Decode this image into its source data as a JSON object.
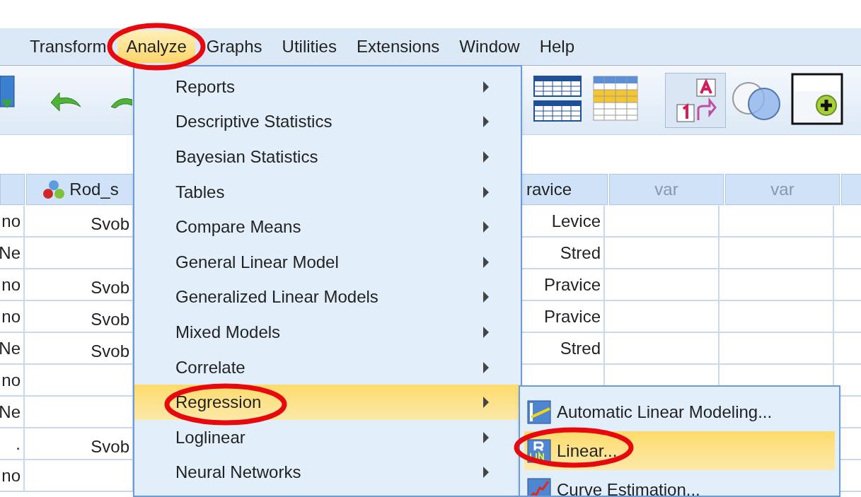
{
  "menu_bar": [
    {
      "label": "Transform",
      "selected": false
    },
    {
      "label": "Analyze",
      "selected": true
    },
    {
      "label": "Graphs",
      "selected": false
    },
    {
      "label": "Utilities",
      "selected": false
    },
    {
      "label": "Extensions",
      "selected": false
    },
    {
      "label": "Window",
      "selected": false
    },
    {
      "label": "Help",
      "selected": false
    }
  ],
  "toolbar": {
    "chart_builder_pressed": true
  },
  "grid": {
    "columns": [
      {},
      {
        "label": "Rod_s",
        "kind": "nominal"
      },
      {
        "label": "ravice"
      },
      {
        "label": "var"
      },
      {
        "label": "var"
      },
      {}
    ],
    "rows": [
      {
        "column_1": "no",
        "column_2": "Svob",
        "column_3": "Levice"
      },
      {
        "column_1": "Ne",
        "column_3": "Stred"
      },
      {
        "column_1": "no",
        "column_2": "Svob",
        "column_3": "Pravice"
      },
      {
        "column_1": "no",
        "column_2": "Svob",
        "column_3": "Pravice"
      },
      {
        "column_1": "Ne",
        "column_2": "Svob",
        "column_3": "Stred"
      },
      {
        "column_1": "no"
      },
      {
        "column_1": "Ne"
      },
      {
        "column_1": ".",
        "column_2": "Svob"
      },
      {
        "column_1": "no"
      }
    ]
  },
  "analyze_menu": [
    {
      "label": "Reports",
      "selected": false
    },
    {
      "label": "Descriptive Statistics",
      "selected": false
    },
    {
      "label": "Bayesian Statistics",
      "selected": false
    },
    {
      "label": "Tables",
      "selected": false
    },
    {
      "label": "Compare Means",
      "selected": false
    },
    {
      "label": "General Linear Model",
      "selected": false
    },
    {
      "label": "Generalized Linear Models",
      "selected": false
    },
    {
      "label": "Mixed Models",
      "selected": false
    },
    {
      "label": "Correlate",
      "selected": false
    },
    {
      "label": "Regression",
      "selected": true
    },
    {
      "label": "Loglinear",
      "selected": false
    },
    {
      "label": "Neural Networks",
      "selected": false
    }
  ],
  "regression_submenu": [
    {
      "label": "Automatic Linear Modeling...",
      "kind": "automatic",
      "selected": false
    },
    {
      "label": "Linear...",
      "kind": "linear",
      "selected": true
    },
    {
      "label": "Curve Estimation...",
      "kind": "curve",
      "selected": false
    }
  ]
}
